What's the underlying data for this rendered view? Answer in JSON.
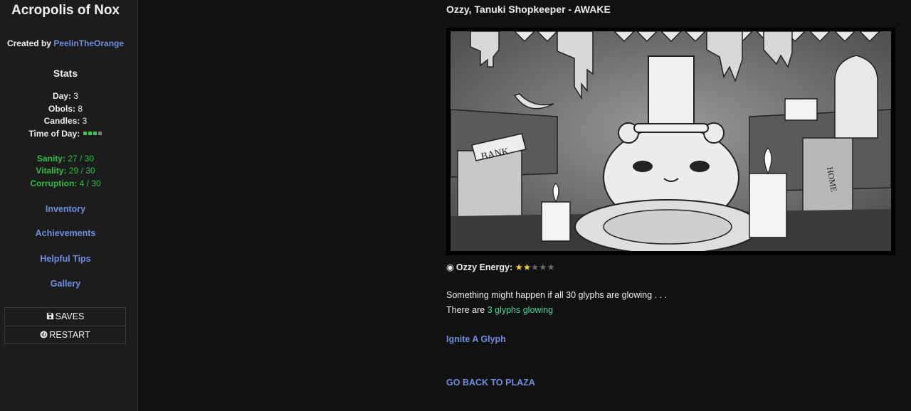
{
  "sidebar": {
    "title": "Acropolis of Nox",
    "created_by_label": "Created by",
    "author": "PeelinTheOrange",
    "stats_heading": "Stats",
    "stats": {
      "day_label": "Day:",
      "day_value": "3",
      "obols_label": "Obols:",
      "obols_value": "8",
      "candles_label": "Candles:",
      "candles_value": "3",
      "time_of_day_label": "Time of Day:",
      "time_of_day_filled": 3,
      "time_of_day_total": 4
    },
    "vitals": {
      "sanity_label": "Sanity:",
      "sanity_value": "27 / 30",
      "vitality_label": "Vitality:",
      "vitality_value": "29 / 30",
      "corruption_label": "Corruption:",
      "corruption_value": "4 / 30"
    },
    "links": {
      "inventory": "Inventory",
      "achievements": "Achievements",
      "tips": "Helpful Tips",
      "gallery": "Gallery"
    },
    "menu": {
      "saves": "SAVES",
      "restart": "RESTART"
    }
  },
  "passage": {
    "title": "Ozzy, Tanuki Shopkeeper - AWAKE",
    "energy_label": "Ozzy Energy:",
    "energy_stars_filled": 2,
    "energy_stars_total": 5,
    "line1": "Something might happen if all 30 glyphs are glowing . . .",
    "line2_prefix": "There are",
    "line2_highlight": "3 glyphs glowing",
    "action_link": "Ignite A Glyph",
    "back_link": "GO BACK TO PLAZA",
    "scene_signs": {
      "bank": "BANK",
      "home": "HOME"
    }
  },
  "colors": {
    "link": "#6e8fe0",
    "vitals_green": "#2ebd44",
    "glyph_highlight": "#4ad39a",
    "star_filled": "#f2d531",
    "star_empty": "#6a6a6a",
    "time_filled": "#3cc24a",
    "time_empty": "#7a7a7a"
  },
  "icons": {
    "saves": "floppy-disk-icon",
    "restart": "power-icon",
    "energy_bullet": "radio-dot-icon"
  }
}
